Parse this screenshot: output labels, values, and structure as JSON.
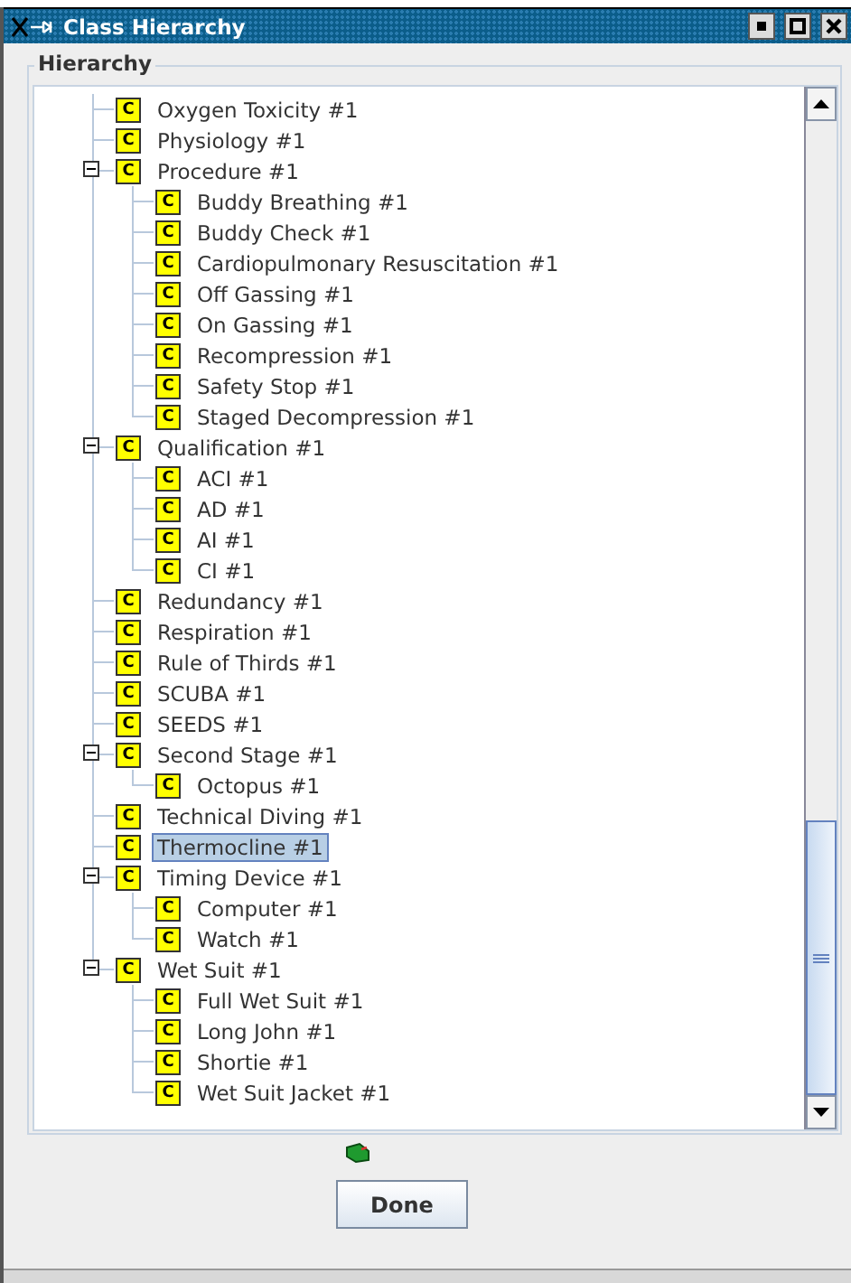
{
  "window": {
    "title": "Class Hierarchy"
  },
  "group": {
    "title": "Hierarchy"
  },
  "tree": [
    {
      "label": "Oxygen Toxicity #1",
      "badge": "C",
      "selected": false
    },
    {
      "label": "Physiology #1",
      "badge": "C",
      "selected": false
    },
    {
      "label": "Procedure #1",
      "badge": "C",
      "selected": false,
      "expanded": true,
      "children": [
        {
          "label": "Buddy Breathing #1",
          "badge": "C",
          "selected": false
        },
        {
          "label": "Buddy Check #1",
          "badge": "C",
          "selected": false
        },
        {
          "label": "Cardiopulmonary Resuscitation #1",
          "badge": "C",
          "selected": false
        },
        {
          "label": "Off Gassing #1",
          "badge": "C",
          "selected": false
        },
        {
          "label": "On Gassing #1",
          "badge": "C",
          "selected": false
        },
        {
          "label": "Recompression #1",
          "badge": "C",
          "selected": false
        },
        {
          "label": "Safety Stop #1",
          "badge": "C",
          "selected": false
        },
        {
          "label": "Staged Decompression #1",
          "badge": "C",
          "selected": false
        }
      ]
    },
    {
      "label": "Qualification #1",
      "badge": "C",
      "selected": false,
      "expanded": true,
      "children": [
        {
          "label": "ACI #1",
          "badge": "C",
          "selected": false
        },
        {
          "label": "AD #1",
          "badge": "C",
          "selected": false
        },
        {
          "label": "AI #1",
          "badge": "C",
          "selected": false
        },
        {
          "label": "CI #1",
          "badge": "C",
          "selected": false
        }
      ]
    },
    {
      "label": "Redundancy #1",
      "badge": "C",
      "selected": false
    },
    {
      "label": "Respiration #1",
      "badge": "C",
      "selected": false
    },
    {
      "label": "Rule of Thirds #1",
      "badge": "C",
      "selected": false
    },
    {
      "label": "SCUBA #1",
      "badge": "C",
      "selected": false
    },
    {
      "label": "SEEDS #1",
      "badge": "C",
      "selected": false
    },
    {
      "label": "Second Stage #1",
      "badge": "C",
      "selected": false,
      "expanded": true,
      "children": [
        {
          "label": "Octopus #1",
          "badge": "C",
          "selected": false
        }
      ]
    },
    {
      "label": "Technical Diving #1",
      "badge": "C",
      "selected": false
    },
    {
      "label": "Thermocline #1",
      "badge": "C",
      "selected": true
    },
    {
      "label": "Timing Device #1",
      "badge": "C",
      "selected": false,
      "expanded": true,
      "children": [
        {
          "label": "Computer #1",
          "badge": "C",
          "selected": false
        },
        {
          "label": "Watch #1",
          "badge": "C",
          "selected": false
        }
      ]
    },
    {
      "label": "Wet Suit #1",
      "badge": "C",
      "selected": false,
      "expanded": true,
      "children": [
        {
          "label": "Full Wet Suit #1",
          "badge": "C",
          "selected": false
        },
        {
          "label": "Long John #1",
          "badge": "C",
          "selected": false
        },
        {
          "label": "Shortie #1",
          "badge": "C",
          "selected": false
        },
        {
          "label": "Wet Suit Jacket #1",
          "badge": "C",
          "selected": false
        }
      ]
    }
  ],
  "buttons": [
    {
      "label": "Done"
    }
  ]
}
